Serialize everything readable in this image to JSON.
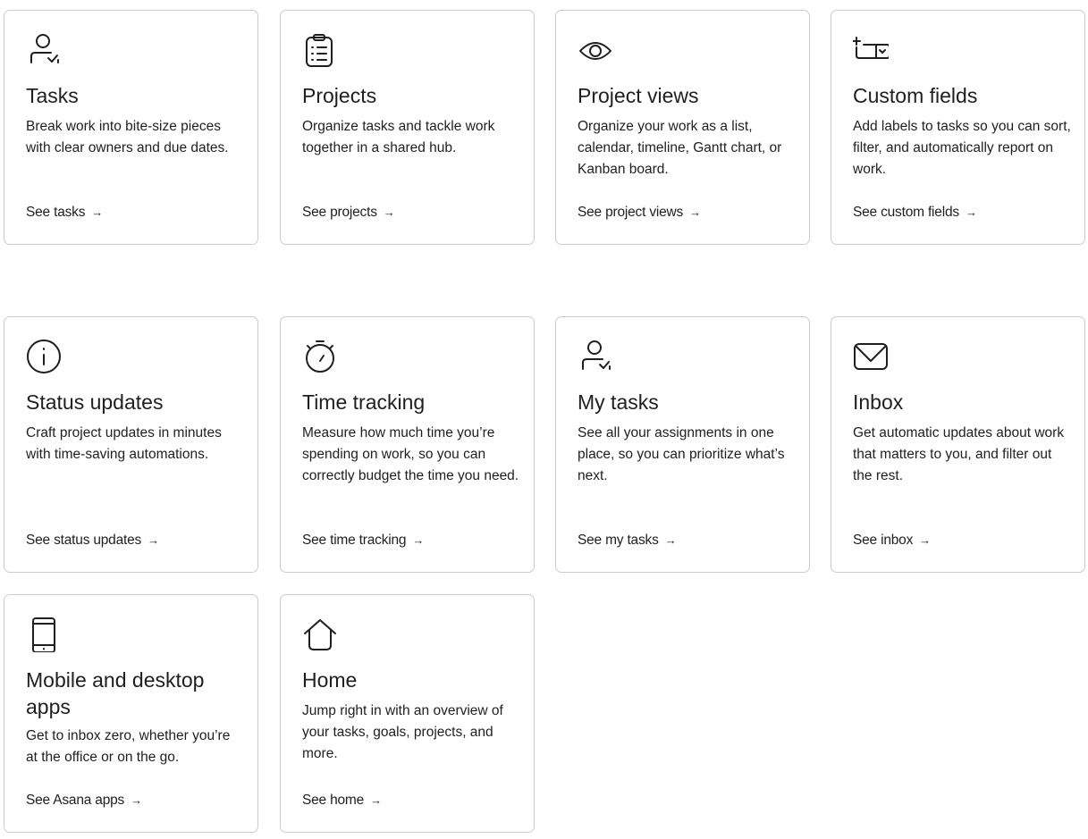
{
  "cards": [
    {
      "icon": "user-check-icon",
      "title": "Tasks",
      "description": "Break work into bite-size pieces with clear owners and due dates.",
      "link": "See tasks",
      "arrow": "→"
    },
    {
      "icon": "clipboard-list-icon",
      "title": "Projects",
      "description": "Organize tasks and tackle work together in a shared hub.",
      "link": "See projects",
      "arrow": "→"
    },
    {
      "icon": "eye-icon",
      "title": "Project views",
      "description": "Organize your work as a list, calendar, timeline, Gantt chart, or Kanban board.",
      "link": "See project views",
      "arrow": "→"
    },
    {
      "icon": "custom-field-add-icon",
      "title": "Custom fields",
      "description": "Add labels to tasks so you can sort, filter, and automatically report on work.",
      "link": "See custom fields",
      "arrow": "→"
    },
    {
      "icon": "info-circle-icon",
      "title": "Status updates",
      "description": "Craft project updates in minutes with time-saving automations.",
      "link": "See status updates",
      "arrow": "→"
    },
    {
      "icon": "stopwatch-icon",
      "title": "Time tracking",
      "description": "Measure how much time you’re spending on work, so you can correctly budget the time you need.",
      "link": "See time tracking",
      "arrow": "→"
    },
    {
      "icon": "user-check-icon",
      "title": "My tasks",
      "description": "See all your assignments in one place, so you can prioritize what’s next.",
      "link": "See my tasks",
      "arrow": "→"
    },
    {
      "icon": "envelope-icon",
      "title": "Inbox",
      "description": "Get automatic updates about work that matters to you, and filter out the rest.",
      "link": "See inbox",
      "arrow": "→"
    },
    {
      "icon": "mobile-phone-icon",
      "title": "Mobile and desktop apps",
      "description": "Get to inbox zero, whether you’re at the office or on the go.",
      "link": "See Asana apps",
      "arrow": "→"
    },
    {
      "icon": "home-icon",
      "title": "Home",
      "description": "Jump right in with an overview of your tasks, goals, projects, and more.",
      "link": "See home",
      "arrow": "→"
    }
  ]
}
